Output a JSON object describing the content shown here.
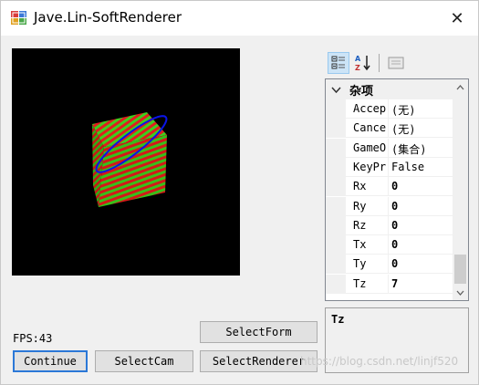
{
  "window": {
    "title": "Jave.Lin-SoftRenderer",
    "close_glyph": "✕"
  },
  "viewport": {
    "background": "#000000",
    "cube_colors": [
      "#e01e1e",
      "#3ccf1e"
    ],
    "ellipse_color": "#0a14e6"
  },
  "status": {
    "fps": "FPS:43"
  },
  "buttons": {
    "continue": "Continue",
    "select_cam": "SelectCam",
    "select_renderer": "SelectRenderer",
    "select_form": "SelectForm"
  },
  "property_grid": {
    "toolbar": {
      "categorized_icon": "categorized-icon",
      "alphabetical_icon": "alphabetical-sort-icon",
      "property_pages_icon": "property-pages-icon"
    },
    "category": "杂项",
    "rows": [
      {
        "name": "Accep",
        "value": "(无)"
      },
      {
        "name": "Cance",
        "value": "(无)"
      },
      {
        "name": "GameO",
        "value": "(集合)"
      },
      {
        "name": "KeyPr",
        "value": "False"
      },
      {
        "name": "Rx",
        "value": "0"
      },
      {
        "name": "Ry",
        "value": "0"
      },
      {
        "name": "Rz",
        "value": "0"
      },
      {
        "name": "Tx",
        "value": "0"
      },
      {
        "name": "Ty",
        "value": "0"
      },
      {
        "name": "Tz",
        "value": "7"
      }
    ],
    "description_title": "Tz"
  },
  "watermark": "https://blog.csdn.net/linjf520",
  "colors": {
    "accent": "#2b78d7",
    "selected_toolbar": "#cce4f7"
  }
}
